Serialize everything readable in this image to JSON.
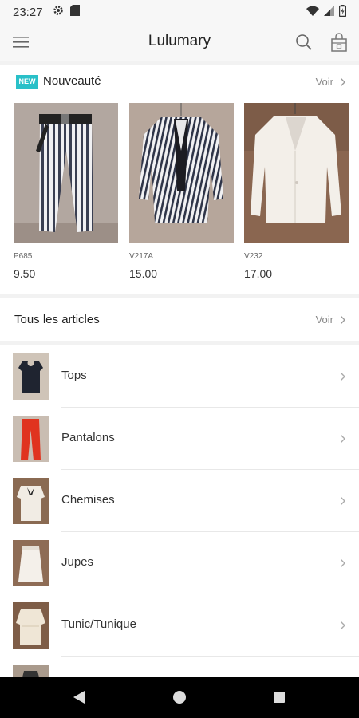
{
  "status_bar": {
    "time": "23:27"
  },
  "app_bar": {
    "title": "Lulumary"
  },
  "new_section": {
    "badge": "NEW",
    "title": "Nouveauté",
    "see_all": "Voir",
    "products": [
      {
        "ref": "P685",
        "price": "9.50"
      },
      {
        "ref": "V217A",
        "price": "15.00"
      },
      {
        "ref": "V232",
        "price": "17.00"
      }
    ]
  },
  "all_section": {
    "title": "Tous les articles",
    "see_all": "Voir"
  },
  "categories": [
    {
      "label": "Tops"
    },
    {
      "label": "Pantalons"
    },
    {
      "label": "Chemises"
    },
    {
      "label": "Jupes"
    },
    {
      "label": "Tunic/Tunique"
    }
  ],
  "colors": {
    "accent": "#29c0c8",
    "nav_bar": "#000000",
    "background": "#f2f2f2"
  }
}
